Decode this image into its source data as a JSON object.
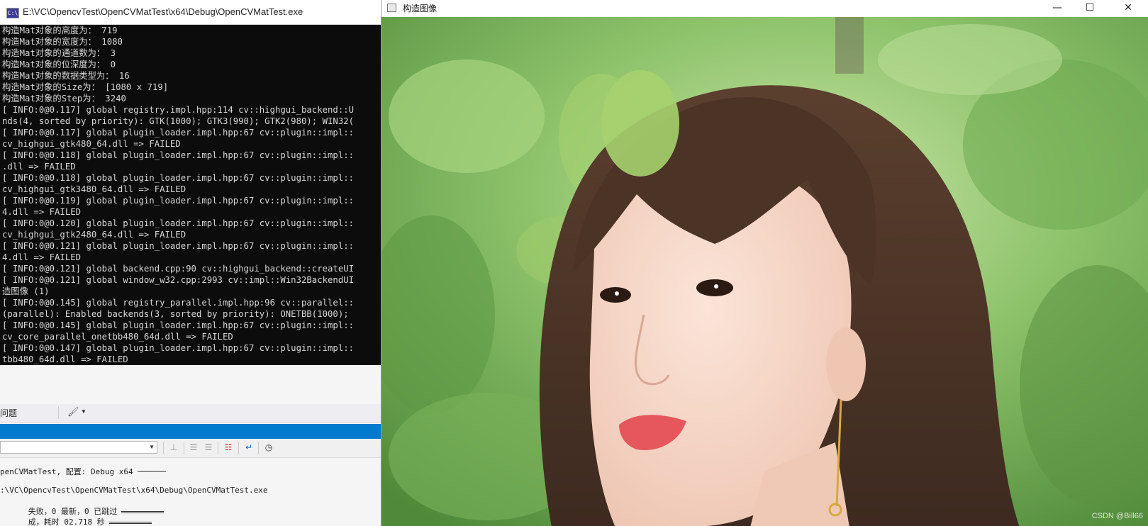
{
  "console_window": {
    "title": "E:\\VC\\OpencvTest\\OpenCVMatTest\\x64\\Debug\\OpenCVMatTest.exe",
    "icon": "console-app-icon",
    "icon_text": "C:\\",
    "lines": [
      "构造Mat对象的高度为： 719",
      "构造Mat对象的宽度为： 1080",
      "构造Mat对象的通道数为： 3",
      "构造Mat对象的位深度为： 0",
      "构造Mat对象的数据类型为： 16",
      "构造Mat对象的Size为： [1080 x 719]",
      "构造Mat对象的Step为： 3240",
      "[ INFO:0@0.117] global registry.impl.hpp:114 cv::highgui_backend::U",
      "nds(4, sorted by priority): GTK(1000); GTK3(990); GTK2(980); WIN32(",
      "[ INFO:0@0.117] global plugin_loader.impl.hpp:67 cv::plugin::impl::",
      "cv_highgui_gtk480_64.dll => FAILED",
      "[ INFO:0@0.118] global plugin_loader.impl.hpp:67 cv::plugin::impl::",
      ".dll => FAILED",
      "[ INFO:0@0.118] global plugin_loader.impl.hpp:67 cv::plugin::impl::",
      "cv_highgui_gtk3480_64.dll => FAILED",
      "[ INFO:0@0.119] global plugin_loader.impl.hpp:67 cv::plugin::impl::",
      "4.dll => FAILED",
      "[ INFO:0@0.120] global plugin_loader.impl.hpp:67 cv::plugin::impl::",
      "cv_highgui_gtk2480_64.dll => FAILED",
      "[ INFO:0@0.121] global plugin_loader.impl.hpp:67 cv::plugin::impl::",
      "4.dll => FAILED",
      "[ INFO:0@0.121] global backend.cpp:90 cv::highgui_backend::createUI",
      "[ INFO:0@0.121] global window_w32.cpp:2993 cv::impl::Win32BackendUI",
      "造图像 (1)",
      "[ INFO:0@0.145] global registry_parallel.impl.hpp:96 cv::parallel::",
      "(parallel): Enabled backends(3, sorted by priority): ONETBB(1000);",
      "[ INFO:0@0.145] global plugin_loader.impl.hpp:67 cv::plugin::impl::",
      "cv_core_parallel_onetbb480_64d.dll => FAILED",
      "[ INFO:0@0.147] global plugin_loader.impl.hpp:67 cv::plugin::impl::",
      "tbb480_64d.dll => FAILED"
    ]
  },
  "vs_panel": {
    "problems_tab": "问题",
    "output_lines": [
      "penCVMatTest, 配置: Debug x64 ──────",
      ":\\VC\\OpencvTest\\OpenCVMatTest\\x64\\Debug\\OpenCVMatTest.exe",
      "失败，0 最新，0 已跳过",
      "成，耗时 02.718 秒"
    ],
    "icons": [
      "brush-icon",
      "find-message-icon",
      "indent-left-icon",
      "indent-right-icon",
      "clear-all-icon",
      "word-wrap-icon",
      "clock-icon"
    ],
    "accent_color": "#007acc"
  },
  "image_window": {
    "title": "构造图像",
    "controls": {
      "minimize": "—",
      "maximize": "☐",
      "close": "✕"
    },
    "watermark": "CSDN @Bill66"
  }
}
